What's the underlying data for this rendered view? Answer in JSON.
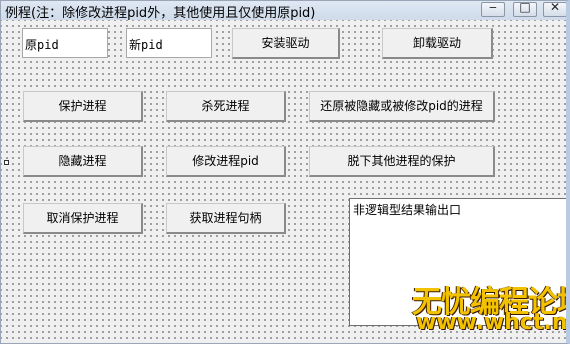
{
  "window": {
    "title": "例程(注：除修改进程pid外，其他使用且仅使用原pid)",
    "controls": [
      "minimize",
      "maximize",
      "close"
    ]
  },
  "fields": {
    "old_pid": "原pid",
    "new_pid": "新pid"
  },
  "buttons": {
    "install_driver": "安装驱动",
    "uninstall_driver": "卸载驱动",
    "protect_process": "保护进程",
    "kill_process": "杀死进程",
    "restore_process": "还原被隐藏或被修改pid的进程",
    "hide_process": "隐藏进程",
    "modify_pid": "修改进程pid",
    "remove_protection": "脱下其他进程的保护",
    "unprotect_process": "取消保护进程",
    "get_handle": "获取进程句柄"
  },
  "output": {
    "text": "非逻辑型结果输出口"
  },
  "watermark": {
    "title": "无忧编程论坛",
    "url": "www.whct.net"
  }
}
